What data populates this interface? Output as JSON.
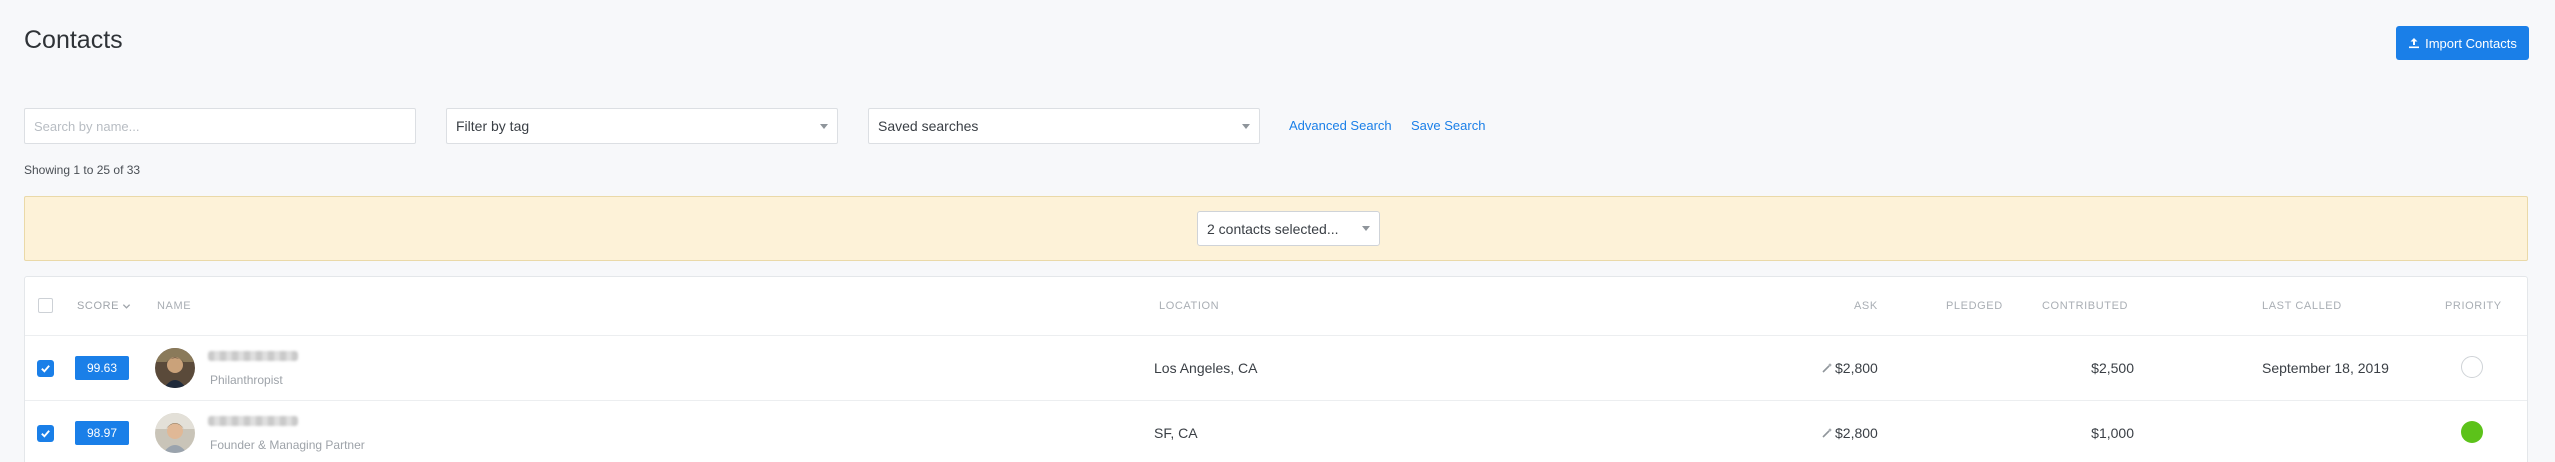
{
  "page": {
    "title": "Contacts",
    "import_button": "Import Contacts"
  },
  "filters": {
    "search_placeholder": "Search by name...",
    "tag_filter": "Filter by tag",
    "saved_searches": "Saved searches",
    "advanced_search": "Advanced Search",
    "save_search": "Save Search",
    "showing": "Showing 1 to 25 of 33"
  },
  "selection": {
    "label": "2 contacts selected..."
  },
  "table": {
    "columns": {
      "score": "Score",
      "name": "Name",
      "location": "Location",
      "ask": "Ask",
      "pledged": "Pledged",
      "contributed": "Contributed",
      "last_called": "Last Called",
      "priority": "Priority"
    },
    "rows": [
      {
        "checked": true,
        "score": "99.63",
        "subtitle": "Philanthropist",
        "location": "Los Angeles, CA",
        "ask": "$2,800",
        "pledged": "",
        "contributed": "$2,500",
        "last_called": "September 18, 2019",
        "priority": "none"
      },
      {
        "checked": true,
        "score": "98.97",
        "subtitle": "Founder & Managing Partner",
        "location": "SF, CA",
        "ask": "$2,800",
        "pledged": "",
        "contributed": "$1,000",
        "last_called": "",
        "priority": "green"
      }
    ]
  },
  "colors": {
    "accent": "#1a7fe8",
    "selection_bar": "#fdf2d8",
    "priority_green": "#5cc21a"
  }
}
